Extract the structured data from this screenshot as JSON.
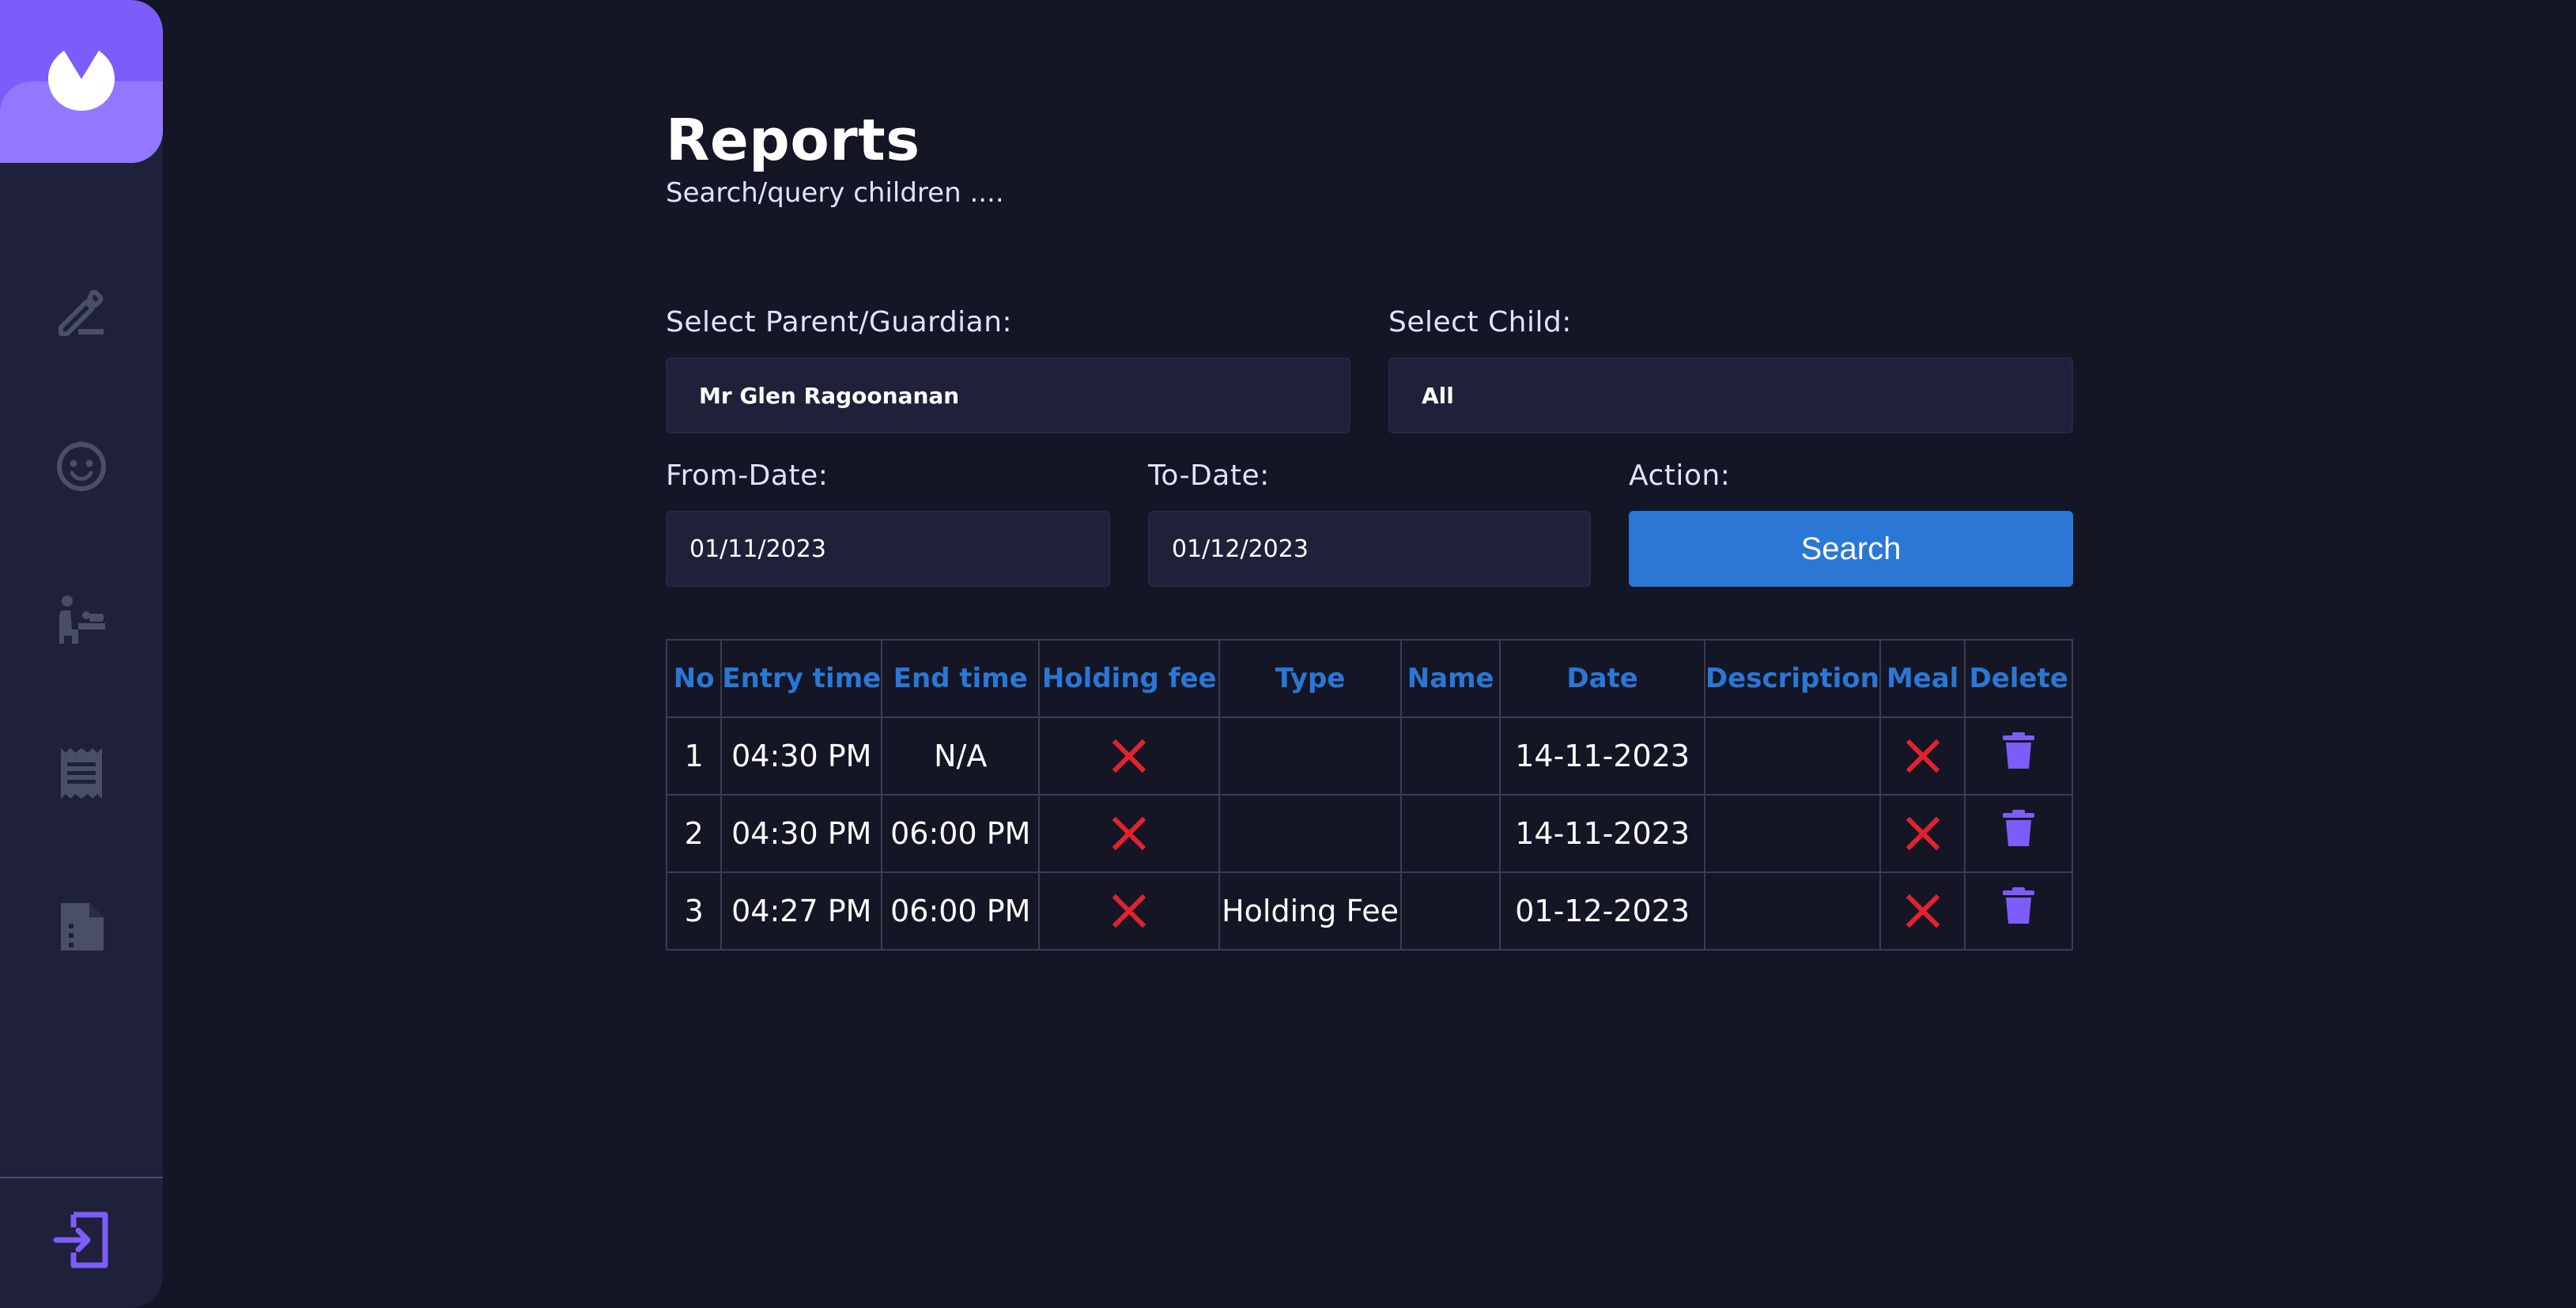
{
  "sidebar": {
    "logo": "logo-icon",
    "items": [
      {
        "icon": "edit-icon"
      },
      {
        "icon": "child-face-icon"
      },
      {
        "icon": "baby-changing-icon"
      },
      {
        "icon": "receipt-icon"
      },
      {
        "icon": "report-file-icon"
      }
    ],
    "exit_icon": "logout-icon"
  },
  "header": {
    "title": "Reports",
    "subtitle": "Search/query children ...."
  },
  "form": {
    "parent_label": "Select Parent/Guardian:",
    "parent_value": "Mr Glen Ragoonanan",
    "child_label": "Select Child:",
    "child_value": "All",
    "from_label": "From-Date:",
    "from_value": "01/11/2023",
    "to_label": "To-Date:",
    "to_value": "01/12/2023",
    "action_label": "Action:",
    "search_label": "Search"
  },
  "table": {
    "headers": [
      "No",
      "Entry time",
      "End time",
      "Holding fee",
      "Type",
      "Name",
      "Date",
      "Description",
      "Meal",
      "Delete"
    ],
    "rows": [
      {
        "no": "1",
        "entry": "04:30 PM",
        "end": "N/A",
        "holding_fee": "x-icon",
        "type": "",
        "name": "",
        "date": "14-11-2023",
        "description": "",
        "meal": "x-icon",
        "delete": "trash-icon"
      },
      {
        "no": "2",
        "entry": "04:30 PM",
        "end": "06:00 PM",
        "holding_fee": "x-icon",
        "type": "",
        "name": "",
        "date": "14-11-2023",
        "description": "",
        "meal": "x-icon",
        "delete": "trash-icon"
      },
      {
        "no": "3",
        "entry": "04:27 PM",
        "end": "06:00 PM",
        "holding_fee": "x-icon",
        "type": "Holding Fee",
        "name": "",
        "date": "01-12-2023",
        "description": "",
        "meal": "x-icon",
        "delete": "trash-icon"
      }
    ]
  },
  "colors": {
    "background": "#141625",
    "sidebar": "#1e2139",
    "accent": "#7c5dfa",
    "header_text": "#2a77d6",
    "button": "#2a77d6",
    "x_mark": "#e3222f",
    "sidebar_icon": "#4b4f66"
  }
}
